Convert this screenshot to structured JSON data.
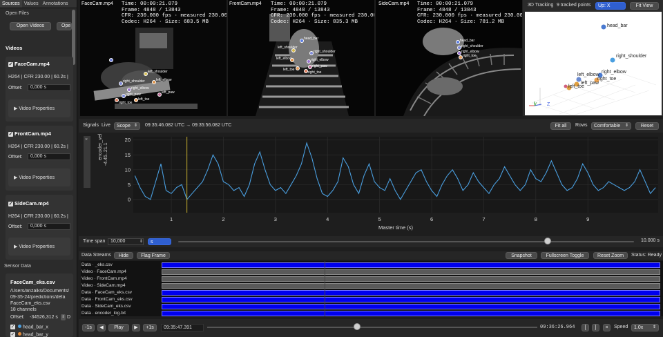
{
  "tabs": [
    "Sources",
    "Values",
    "Annotations"
  ],
  "sidebar": {
    "open_files_label": "Open Files",
    "open_videos": "Open Videos",
    "open_other": "Ope",
    "videos_title": "Videos",
    "videos": [
      {
        "name": "FaceCam.mp4",
        "codec": "H264 | CFR 230.00 | 60.2s |",
        "offset_label": "Offset:",
        "offset": "0,000 s",
        "props": "▶  Video Properties"
      },
      {
        "name": "FrontCam.mp4",
        "codec": "H264 | CFR 230.00 | 60.2s |",
        "offset_label": "Offset:",
        "offset": "0,000 s",
        "props": "▶  Video Properties"
      },
      {
        "name": "SideCam.mp4",
        "codec": "H264 | CFR 230.00 | 60.2s |",
        "offset_label": "Offset:",
        "offset": "0,000 s",
        "props": "▶  Video Properties"
      }
    ],
    "sensor_title": "Sensor Data",
    "sensor": {
      "name": "FaceCam_eks.csv",
      "path1": "/Users/anzalks/Documents/",
      "path2": "09-35-24/predictions/defa",
      "file": "FaceCam_eks.csv",
      "channels": "18 channels",
      "offset_label": "Offset:",
      "offset": "-34526,312 s",
      "offset_suffix": "D",
      "ch1": "head_bar_x",
      "ch2": "head_bar_y"
    }
  },
  "videos": [
    {
      "name": "FaceCam.mp4",
      "info": "Time: 00:00:21.079\nFrame: 4848 / 13843\nCFR: 230.000 fps · measured 230.000\nCodec: H264 · Size: 683.5 MB"
    },
    {
      "name": "FrontCam.mp4",
      "info": "Time: 00:00:21.079\nFrame: 4848 / 13843\nCFR: 230.000 fps · measured 230.000\nCodec: H264 · Size: 835.3 MB"
    },
    {
      "name": "SideCam.mp4",
      "info": "Time: 00:00:21.079\nFrame: 4848 / 13843\nCFR: 230.000 fps · measured 230.000\nCodec: H264 · Size: 781.2 MB"
    }
  ],
  "keypoints": {
    "face": [
      "left_shoulder",
      "right_shoulder",
      "left_elbow",
      "right_elbow",
      "left_paw",
      "right_paw",
      "left_toe",
      "right_toe"
    ],
    "front": [
      "head_bar",
      "left_shoulder",
      "right_shoulder",
      "left_elbow",
      "right_elbow",
      "right_paw",
      "left_toe",
      "right_toe"
    ],
    "side": [
      "head_bar",
      "right_shoulder",
      "right_elbow",
      "right_toe"
    ]
  },
  "tracking": {
    "title": "3D Tracking",
    "count": "9 tracked points",
    "up": "Up: X",
    "fit": "Fit View",
    "points": [
      "head_bar",
      "right_shoulder",
      "left_elbow",
      "right_elbow",
      "left_paw",
      "right_toe",
      "left_toe"
    ],
    "axis_y": "Y",
    "axis_z": "Z"
  },
  "signals": {
    "label": "Signals",
    "live": "Live",
    "scope": "Scope",
    "range": "09:35:46.082 UTC → 09:35:56.082 UTC",
    "fit_all": "Fit all",
    "rows_label": "Rows",
    "rows_value": "Comfortable",
    "reset": "Reset",
    "close_mark": "×"
  },
  "chart_data": {
    "type": "line",
    "ylabel": "encoder_velocity",
    "ylabel2": "-4.45..21.1",
    "xlabel": "Master time (s)",
    "xlim": [
      0.27,
      10.35
    ],
    "ylim": [
      -4.45,
      21.1
    ],
    "xticks": [
      1,
      2,
      3,
      4,
      5,
      6,
      7,
      8,
      9
    ],
    "yticks": [
      0,
      5,
      10,
      15,
      20
    ],
    "cursor_x": 1.3,
    "series": [
      {
        "color": "#4a9fe0",
        "x": [
          0.3,
          0.4,
          0.5,
          0.6,
          0.7,
          0.8,
          0.9,
          1.0,
          1.1,
          1.2,
          1.3,
          1.4,
          1.5,
          1.6,
          1.7,
          1.8,
          1.9,
          2.0,
          2.1,
          2.2,
          2.3,
          2.4,
          2.5,
          2.6,
          2.7,
          2.8,
          2.9,
          3.0,
          3.1,
          3.2,
          3.3,
          3.4,
          3.5,
          3.6,
          3.7,
          3.8,
          3.9,
          4.0,
          4.1,
          4.2,
          4.3,
          4.4,
          4.5,
          4.6,
          4.7,
          4.8,
          4.9,
          5.0,
          5.1,
          5.2,
          5.3,
          5.4,
          5.5,
          5.6,
          5.7,
          5.8,
          5.9,
          6.0,
          6.1,
          6.2,
          6.3,
          6.4,
          6.5,
          6.6,
          6.7,
          6.8,
          6.9,
          7.0,
          7.1,
          7.2,
          7.3,
          7.4,
          7.5,
          7.6,
          7.7,
          7.8,
          7.9,
          8.0,
          8.1,
          8.2,
          8.3,
          8.4,
          8.5,
          8.6,
          8.7,
          8.8,
          8.9,
          9.0,
          9.1,
          9.2,
          9.3,
          9.4,
          9.5,
          9.6,
          9.7,
          9.8,
          9.9,
          10.0,
          10.1,
          10.2,
          10.3
        ],
        "y": [
          8,
          4,
          1,
          0,
          6,
          12,
          3,
          2,
          4,
          5,
          0,
          2,
          4,
          6,
          10,
          15,
          12,
          6,
          5,
          3,
          4,
          1,
          5,
          12,
          16,
          10,
          5,
          3,
          4,
          2,
          5,
          8,
          12,
          19,
          14,
          7,
          2,
          1,
          3,
          6,
          14,
          11,
          5,
          2,
          8,
          12,
          6,
          4,
          3,
          7,
          3,
          0,
          3,
          6,
          9,
          10,
          6,
          3,
          1,
          5,
          8,
          10,
          7,
          3,
          5,
          9,
          6,
          4,
          2,
          5,
          7,
          11,
          8,
          5,
          3,
          5,
          10,
          7,
          6,
          9,
          13,
          9,
          5,
          3,
          4,
          7,
          12,
          9,
          5,
          3,
          4,
          6,
          5,
          4,
          3,
          4,
          6,
          10,
          6,
          2,
          4
        ]
      }
    ]
  },
  "timespan": {
    "label": "Time span",
    "value": "10,000",
    "unit": "s",
    "max": "10.000 s",
    "slider_fraction": 0.81
  },
  "datastreams": {
    "label": "Data Streams",
    "hide": "Hide",
    "flag": "Flag Frame",
    "snapshot": "Snapshot",
    "fullscreen": "Fullscreen Toggle",
    "reset_zoom": "Reset Zoom",
    "status": "Status: Ready",
    "rows": [
      {
        "label": "Data · _eks.csv",
        "kind": "data"
      },
      {
        "label": "Video · FaceCam.mp4",
        "kind": "video"
      },
      {
        "label": "Video · FrontCam.mp4",
        "kind": "video"
      },
      {
        "label": "Video · SideCam.mp4",
        "kind": "video"
      },
      {
        "label": "Data · FaceCam_eks.csv",
        "kind": "data"
      },
      {
        "label": "Data · FrontCam_eks.csv",
        "kind": "data"
      },
      {
        "label": "Data · SideCam_eks.csv",
        "kind": "data"
      },
      {
        "label": "Data · encoder_log.txt",
        "kind": "data"
      }
    ]
  },
  "timeline": {
    "minus1": "-1s",
    "prev": "◀",
    "play": "Play",
    "next": "▶",
    "plus1": "+1s",
    "current": "09:35:47.391",
    "end": "09:36:26.964",
    "b1": "[",
    "b2": "]",
    "b3": "×",
    "speed_label": "Speed",
    "speed": "1.0x",
    "position_fraction": 0.455
  },
  "colors": {
    "accent": "#2f5fd0",
    "stream": "#0000ee",
    "signal": "#4a9fe0"
  }
}
